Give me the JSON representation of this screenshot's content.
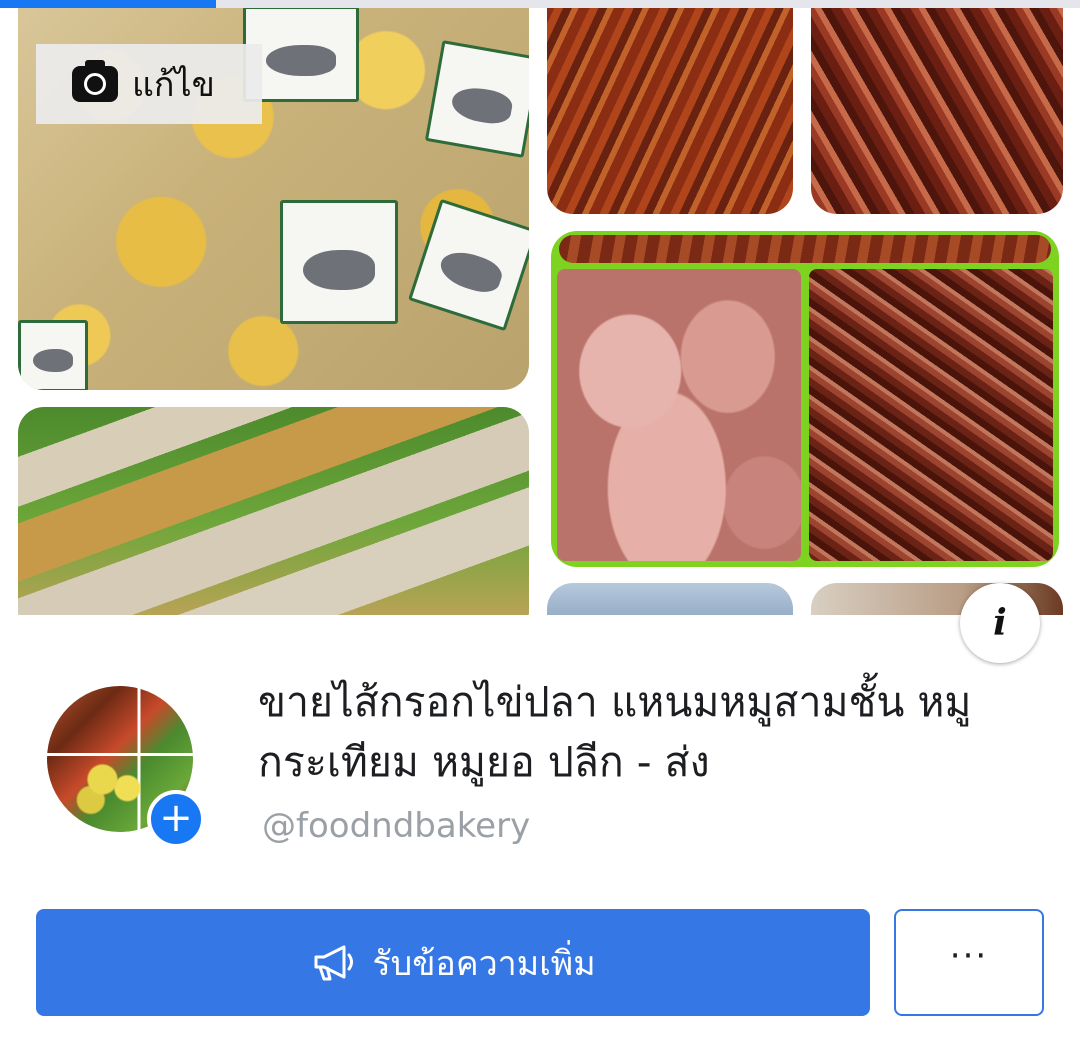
{
  "progress": {
    "value": 0.2
  },
  "cover": {
    "edit_label": "แก้ไข",
    "edit_icon": "camera-icon",
    "info_glyph": "i"
  },
  "profile": {
    "name": "ขายไส้กรอกไข่ปลา แหนมหมูสามชั้น หมูกระเทียม หมูยอ ปลีก - ส่ง",
    "handle": "@foodndbakery",
    "avatar_add_glyph": "+"
  },
  "actions": {
    "send_message_label": "รับข้อความเพิ่ม",
    "send_message_icon": "megaphone-icon",
    "more_glyph": "···"
  },
  "colors": {
    "primary": "#3578e5",
    "accent_blue": "#1877f2",
    "handle_gray": "#9aa0a6"
  }
}
